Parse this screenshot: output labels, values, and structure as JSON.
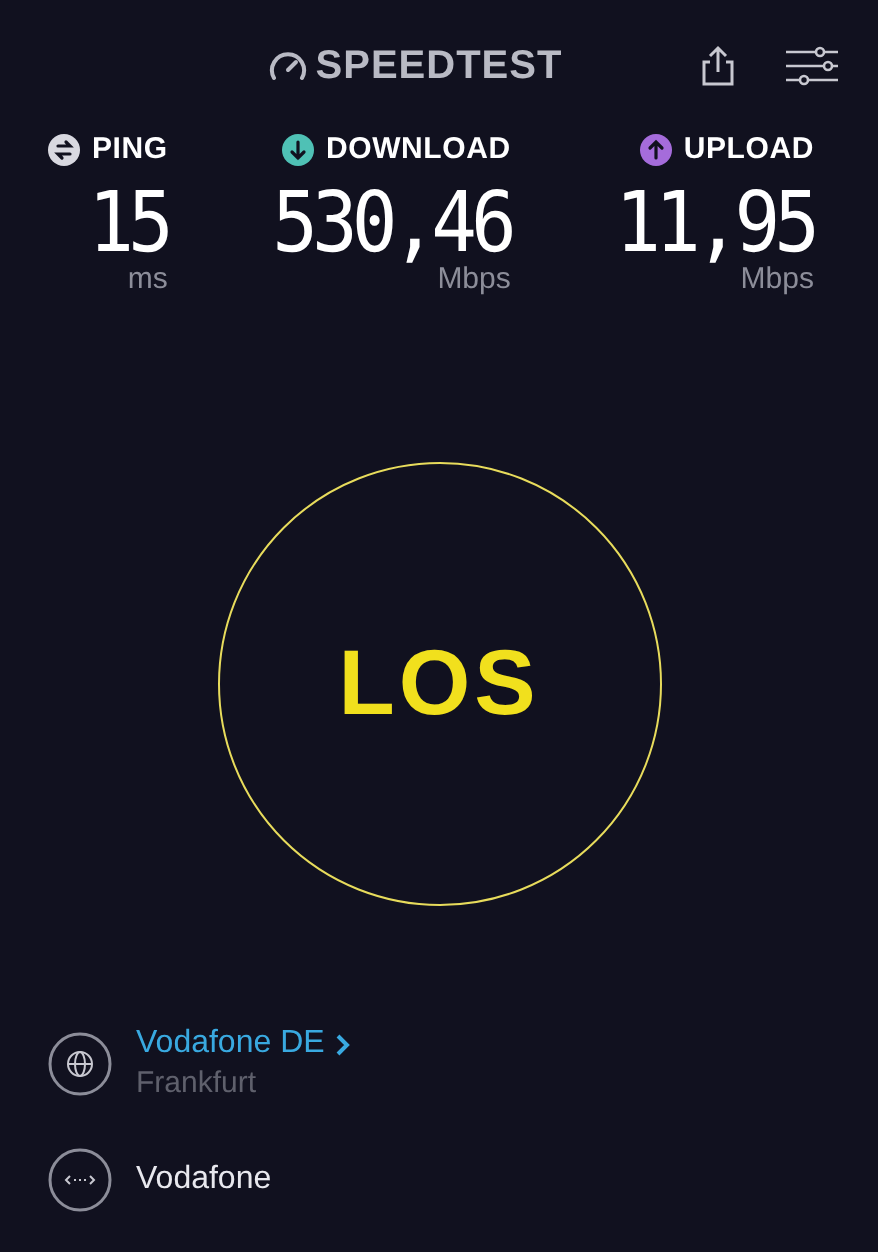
{
  "header": {
    "logo": "SPEEDTEST"
  },
  "metrics": [
    {
      "kind": "ping",
      "label": "PING",
      "value": "15",
      "unit": "ms",
      "color": "#d8d8e0"
    },
    {
      "kind": "download",
      "label": "DOWNLOAD",
      "value": "530,46",
      "unit": "Mbps",
      "color": "#4fc1b5"
    },
    {
      "kind": "upload",
      "label": "UPLOAD",
      "value": "11,95",
      "unit": "Mbps",
      "color": "#a56cdb"
    }
  ],
  "start_button": {
    "label": "LOS"
  },
  "server": {
    "name": "Vodafone DE",
    "location": "Frankfurt"
  },
  "provider": {
    "name": "Vodafone"
  }
}
